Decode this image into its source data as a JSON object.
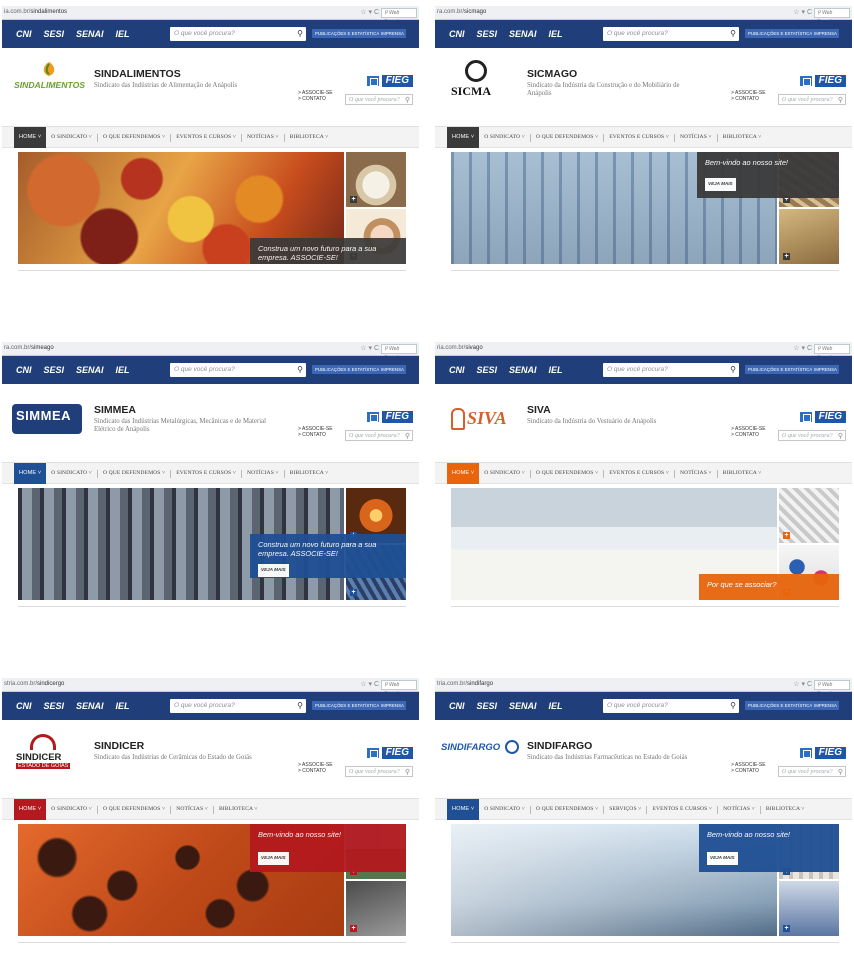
{
  "common": {
    "brands": [
      "CNI",
      "SESI",
      "SENAI",
      "IEL"
    ],
    "search_placeholder": "O que você procura?",
    "publications_label": "PUBLICAÇÕES E ESTATÍSTICAS",
    "press_label": "IMPRENSA",
    "web_search_label": "Web Search",
    "associe_label": "> ASSOCIE-SE",
    "contato_label": "> CONTATO",
    "fieg_label": "FIEG",
    "header_search_placeholder": "O que você procura?",
    "more_label": "VEJA MAIS"
  },
  "panels": [
    {
      "url_prefix": "ia.com.br/",
      "url_path": "sindalimentos",
      "name": "SINDALIMENTOS",
      "description": "Sindicato das Indústrias de Alimentação de Anápolis",
      "logo_text": "SINDALIMENTOS",
      "accent": "#3a3a3a",
      "nav": [
        "HOME",
        "O SINDICATO",
        "O QUE DEFENDEMOS",
        "EVENTOS E CURSOS",
        "NOTÍCIAS",
        "BIBLIOTECA"
      ],
      "caption": "Construa um novo futuro para a sua empresa. ASSOCIE-SE!"
    },
    {
      "url_prefix": "ra.com.br/",
      "url_path": "sicmago",
      "name": "SICMAGO",
      "description": "Sindicato da Indústria da Construção e do Mobiliário de Anápolis",
      "logo_text": "SICMA",
      "accent": "#3a3a3a",
      "nav": [
        "HOME",
        "O SINDICATO",
        "O QUE DEFENDEMOS",
        "EVENTOS E CURSOS",
        "NOTÍCIAS",
        "BIBLIOTECA"
      ],
      "caption": "Bem-vindo ao nosso site!"
    },
    {
      "url_prefix": "ra.com.br/",
      "url_path": "simeago",
      "name": "SIMMEA",
      "description": "Sindicato das Indústrias Metalúrgicas, Mecânicas e de Material Elétrico de Anápolis",
      "logo_text": "SIMMEA",
      "accent": "#1f4f94",
      "nav": [
        "HOME",
        "O SINDICATO",
        "O QUE DEFENDEMOS",
        "EVENTOS E CURSOS",
        "NOTÍCIAS",
        "BIBLIOTECA"
      ],
      "caption": "Construa um novo futuro para a sua empresa. ASSOCIE-SE!"
    },
    {
      "url_prefix": "ria.com.br/",
      "url_path": "sivago",
      "name": "SIVA",
      "description": "Sindicato da Indústria do Vestuário de Anápolis",
      "logo_text": "SIVA",
      "accent": "#e8650c",
      "nav": [
        "HOME",
        "O SINDICATO",
        "O QUE DEFENDEMOS",
        "EVENTOS E CURSOS",
        "NOTÍCIAS",
        "BIBLIOTECA"
      ],
      "caption": "Por que se associar?"
    },
    {
      "url_prefix": "stria.com.br/",
      "url_path": "sindicergo",
      "name": "SINDICER",
      "description": "Sindicato das Indústrias de Cerâmicas do Estado de Goiás",
      "logo_text": "SINDICER",
      "logo_sub": "ESTADO DE GOIÁS",
      "accent": "#b3191e",
      "nav": [
        "HOME",
        "O SINDICATO",
        "O QUE DEFENDEMOS",
        "NOTÍCIAS",
        "BIBLIOTECA"
      ],
      "caption": "Bem-vindo ao nosso site!"
    },
    {
      "url_prefix": "tria.com.br/",
      "url_path": "sindifargo",
      "name": "SINDIFARGO",
      "description": "Sindicato das Indústrias Farmacêuticas no Estado de Goiás",
      "logo_text": "SINDIFARGO",
      "accent": "#1f4f94",
      "nav": [
        "HOME",
        "O SINDICATO",
        "O QUE DEFENDEMOS",
        "SERVIÇOS",
        "EVENTOS E CURSOS",
        "NOTÍCIAS",
        "BIBLIOTECA"
      ],
      "caption": "Bem-vindo ao nosso site!"
    }
  ]
}
